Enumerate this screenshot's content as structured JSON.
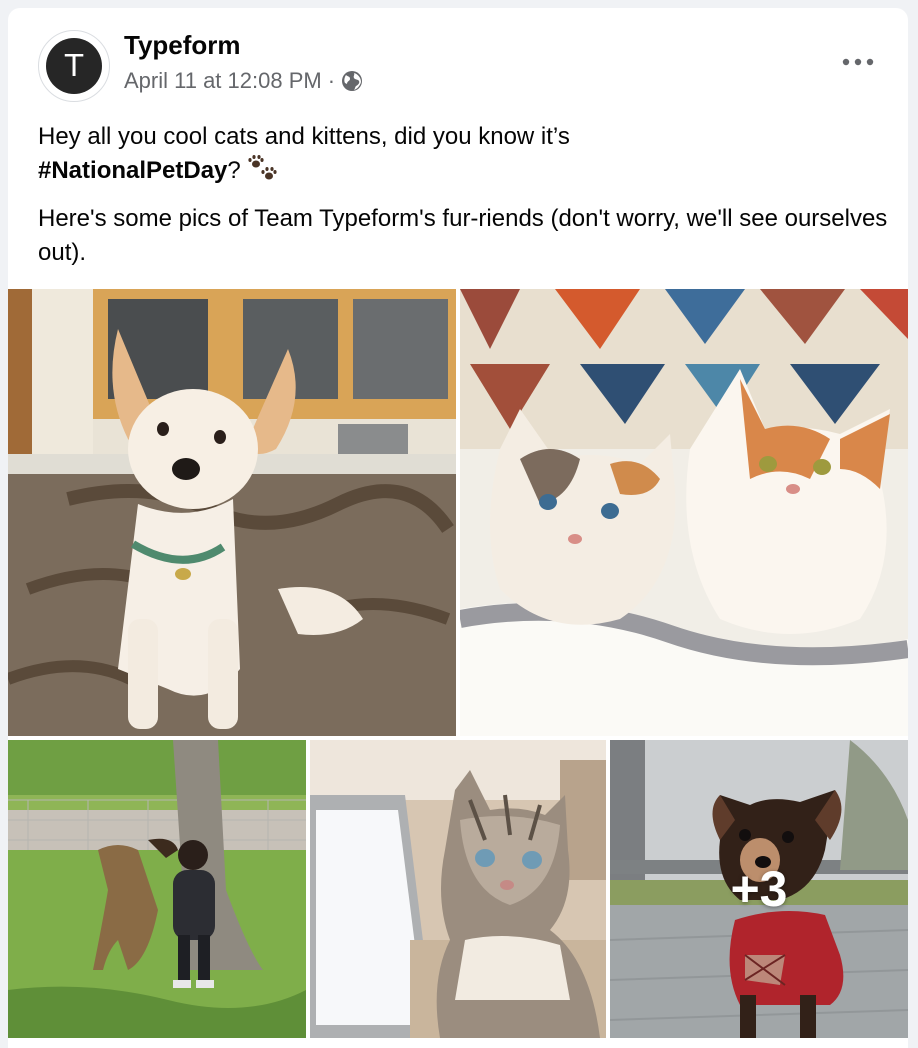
{
  "post": {
    "page_name": "Typeform",
    "avatar_letter": "T",
    "timestamp": "April 11 at 12:08 PM",
    "separator": "·",
    "audience_icon": "globe-icon",
    "more_icon": "more-options-icon",
    "text_line1": "Hey all you cool cats and kittens, did you know it’s",
    "hashtag": "#NationalPetDay",
    "text_after_hashtag": "?",
    "paw_icon": "paw-prints-icon",
    "text_para2": "Here's some pics of Team Typeform's fur-riends (don't worry, we'll see ourselves out)."
  },
  "photos": {
    "items": [
      {
        "name": "white-dog-photo"
      },
      {
        "name": "two-cats-photo"
      },
      {
        "name": "dog-and-child-photo"
      },
      {
        "name": "tabby-cat-laptop-photo"
      },
      {
        "name": "chihuahua-photo"
      }
    ],
    "more_count": "+3"
  },
  "colors": {
    "text_primary": "#050505",
    "text_secondary": "#65676b",
    "card_bg": "#ffffff",
    "page_bg": "#f0f2f5",
    "avatar_bg": "#262626"
  }
}
